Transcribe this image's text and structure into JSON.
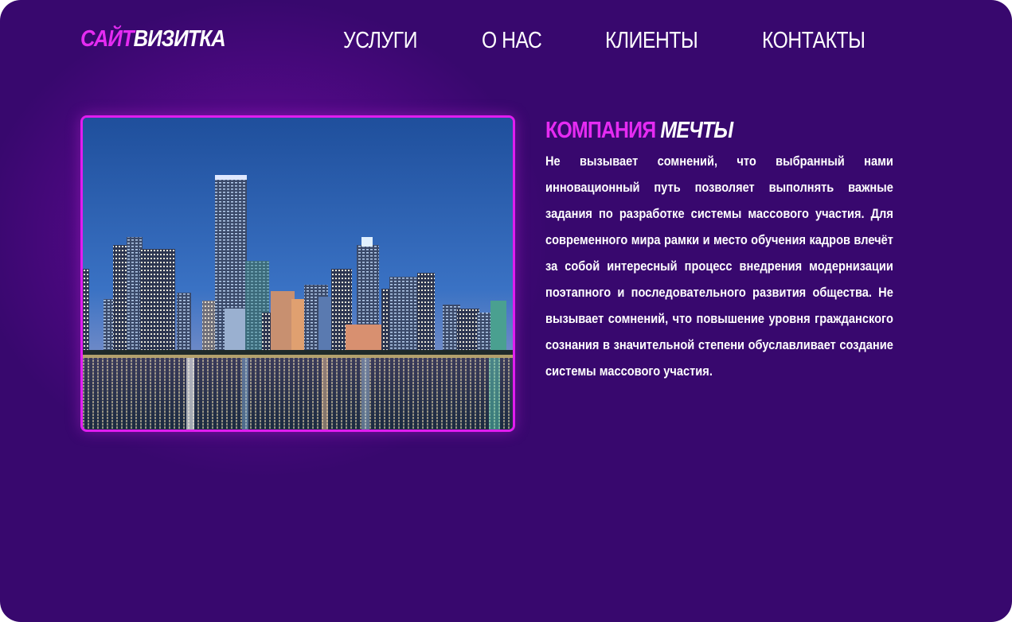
{
  "logo": {
    "part1": "САЙТ",
    "part2": "ВИЗИТКА"
  },
  "nav": {
    "items": [
      {
        "label": "УСЛУГИ"
      },
      {
        "label": "О НАС"
      },
      {
        "label": "КЛИЕНТЫ"
      },
      {
        "label": "КОНТАКТЫ"
      }
    ]
  },
  "hero": {
    "image_icon": "city-skyline-at-night-photo",
    "title_part1": "КОМПАНИЯ",
    "title_part2": "МЕЧТЫ",
    "text": "Не вызывает сомнений, что выбранный нами инновационный путь позволяет выполнять важные задания по разработке системы массового участия. Для современного мира рамки и место обучения кадров влечёт за собой интересный процесс внедрения модернизации поэтапного и последовательного развития общества. Не вызывает сомнений, что повышение уровня гражданского сознания в значительной степени обуславливает создание системы массового участия."
  },
  "colors": {
    "background": "#38086e",
    "accent": "#e52bf2",
    "text": "#ffffff"
  }
}
